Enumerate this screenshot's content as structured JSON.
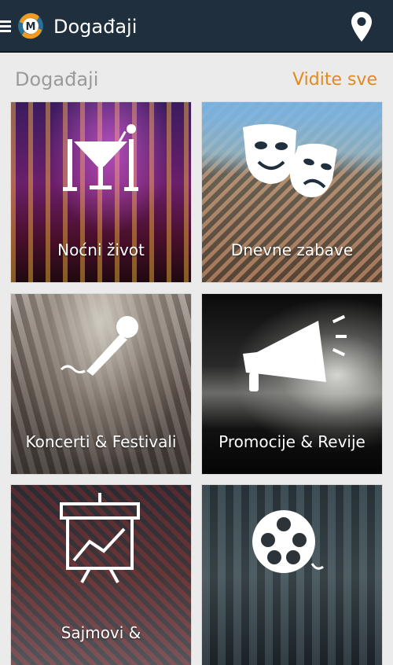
{
  "appbar": {
    "title": "Događaji",
    "menu_icon": "hamburger-menu-icon",
    "logo_icon": "app-logo-icon",
    "location_icon": "location-pin-icon"
  },
  "section": {
    "title": "Događaji",
    "see_all_label": "Vidite sve"
  },
  "colors": {
    "appbar": "#1f2f3d",
    "accent": "#e08a1e",
    "background": "#ebebeb"
  },
  "categories": [
    {
      "label": "Noćni život",
      "icon": "cocktail-glasses-icon"
    },
    {
      "label": "Dnevne zabave",
      "icon": "theater-masks-icon"
    },
    {
      "label": "Koncerti & Festivali",
      "icon": "microphone-icon"
    },
    {
      "label": "Promocije & Revije",
      "icon": "megaphone-icon"
    },
    {
      "label": "Sajmovi &",
      "icon": "presentation-board-icon"
    },
    {
      "label": "",
      "icon": "film-reel-icon"
    }
  ]
}
